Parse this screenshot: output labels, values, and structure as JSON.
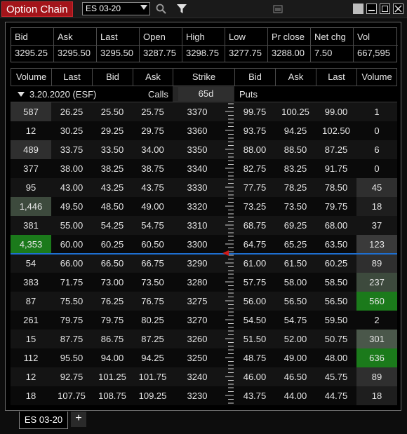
{
  "window": {
    "title": "Option Chain",
    "instrument_select": "ES 03-20",
    "icons": [
      "search-icon",
      "filter-icon",
      "window-icon",
      "minimize-icon",
      "restore-icon",
      "close-icon"
    ]
  },
  "quote": {
    "headers": [
      "Bid",
      "Ask",
      "Last",
      "Open",
      "High",
      "Low",
      "Pr close",
      "Net chg",
      "Vol"
    ],
    "values": [
      "3295.25",
      "3295.50",
      "3295.50",
      "3287.75",
      "3298.75",
      "3277.75",
      "3288.00",
      "7.50",
      "667,595"
    ]
  },
  "chain": {
    "headers": [
      "Volume",
      "Last",
      "Bid",
      "Ask",
      "Strike",
      "Bid",
      "Ask",
      "Last",
      "Volume"
    ],
    "expiry_label": "3.20.2020  (ESF)",
    "calls_label": "Calls",
    "days_label": "65d",
    "puts_label": "Puts",
    "rows": [
      {
        "c_vol": "587",
        "c_last": "26.25",
        "c_bid": "25.50",
        "c_ask": "25.75",
        "strike": "3370",
        "p_bid": "99.75",
        "p_ask": "100.25",
        "p_last": "99.00",
        "p_vol": "1"
      },
      {
        "c_vol": "12",
        "c_last": "30.25",
        "c_bid": "29.25",
        "c_ask": "29.75",
        "strike": "3360",
        "p_bid": "93.75",
        "p_ask": "94.25",
        "p_last": "102.50",
        "p_vol": "0"
      },
      {
        "c_vol": "489",
        "c_last": "33.75",
        "c_bid": "33.50",
        "c_ask": "34.00",
        "strike": "3350",
        "p_bid": "88.00",
        "p_ask": "88.50",
        "p_last": "87.25",
        "p_vol": "6"
      },
      {
        "c_vol": "377",
        "c_last": "38.00",
        "c_bid": "38.25",
        "c_ask": "38.75",
        "strike": "3340",
        "p_bid": "82.75",
        "p_ask": "83.25",
        "p_last": "91.75",
        "p_vol": "0"
      },
      {
        "c_vol": "95",
        "c_last": "43.00",
        "c_bid": "43.25",
        "c_ask": "43.75",
        "strike": "3330",
        "p_bid": "77.75",
        "p_ask": "78.25",
        "p_last": "78.50",
        "p_vol": "45"
      },
      {
        "c_vol": "1,446",
        "c_last": "49.50",
        "c_bid": "48.50",
        "c_ask": "49.00",
        "strike": "3320",
        "p_bid": "73.25",
        "p_ask": "73.50",
        "p_last": "79.75",
        "p_vol": "18"
      },
      {
        "c_vol": "381",
        "c_last": "55.00",
        "c_bid": "54.25",
        "c_ask": "54.75",
        "strike": "3310",
        "p_bid": "68.75",
        "p_ask": "69.25",
        "p_last": "68.00",
        "p_vol": "37"
      },
      {
        "c_vol": "4,353",
        "c_last": "60.00",
        "c_bid": "60.25",
        "c_ask": "60.50",
        "strike": "3300",
        "p_bid": "64.75",
        "p_ask": "65.25",
        "p_last": "63.50",
        "p_vol": "123"
      },
      {
        "c_vol": "54",
        "c_last": "66.00",
        "c_bid": "66.50",
        "c_ask": "66.75",
        "strike": "3290",
        "p_bid": "61.00",
        "p_ask": "61.50",
        "p_last": "60.25",
        "p_vol": "89"
      },
      {
        "c_vol": "383",
        "c_last": "71.75",
        "c_bid": "73.00",
        "c_ask": "73.50",
        "strike": "3280",
        "p_bid": "57.75",
        "p_ask": "58.00",
        "p_last": "58.50",
        "p_vol": "237"
      },
      {
        "c_vol": "87",
        "c_last": "75.50",
        "c_bid": "76.25",
        "c_ask": "76.75",
        "strike": "3275",
        "p_bid": "56.00",
        "p_ask": "56.50",
        "p_last": "56.50",
        "p_vol": "560"
      },
      {
        "c_vol": "261",
        "c_last": "79.75",
        "c_bid": "79.75",
        "c_ask": "80.25",
        "strike": "3270",
        "p_bid": "54.50",
        "p_ask": "54.75",
        "p_last": "59.50",
        "p_vol": "2"
      },
      {
        "c_vol": "15",
        "c_last": "87.75",
        "c_bid": "86.75",
        "c_ask": "87.25",
        "strike": "3260",
        "p_bid": "51.50",
        "p_ask": "52.00",
        "p_last": "50.75",
        "p_vol": "301"
      },
      {
        "c_vol": "112",
        "c_last": "95.50",
        "c_bid": "94.00",
        "c_ask": "94.25",
        "strike": "3250",
        "p_bid": "48.75",
        "p_ask": "49.00",
        "p_last": "48.00",
        "p_vol": "636"
      },
      {
        "c_vol": "12",
        "c_last": "92.75",
        "c_bid": "101.25",
        "c_ask": "101.75",
        "strike": "3240",
        "p_bid": "46.00",
        "p_ask": "46.50",
        "p_last": "45.75",
        "p_vol": "89"
      },
      {
        "c_vol": "18",
        "c_last": "107.75",
        "c_bid": "108.75",
        "c_ask": "109.25",
        "strike": "3230",
        "p_bid": "43.75",
        "p_ask": "44.00",
        "p_last": "44.75",
        "p_vol": "18"
      }
    ]
  },
  "tabs": {
    "active": "ES 03-20",
    "add": "+"
  },
  "colors": {
    "title_bg": "#a3141a",
    "atm_line": "#1e6fd1",
    "vol_green": "#1a6b1a",
    "vol_grey": "#3a3a3a",
    "row_alt": "#151515"
  }
}
